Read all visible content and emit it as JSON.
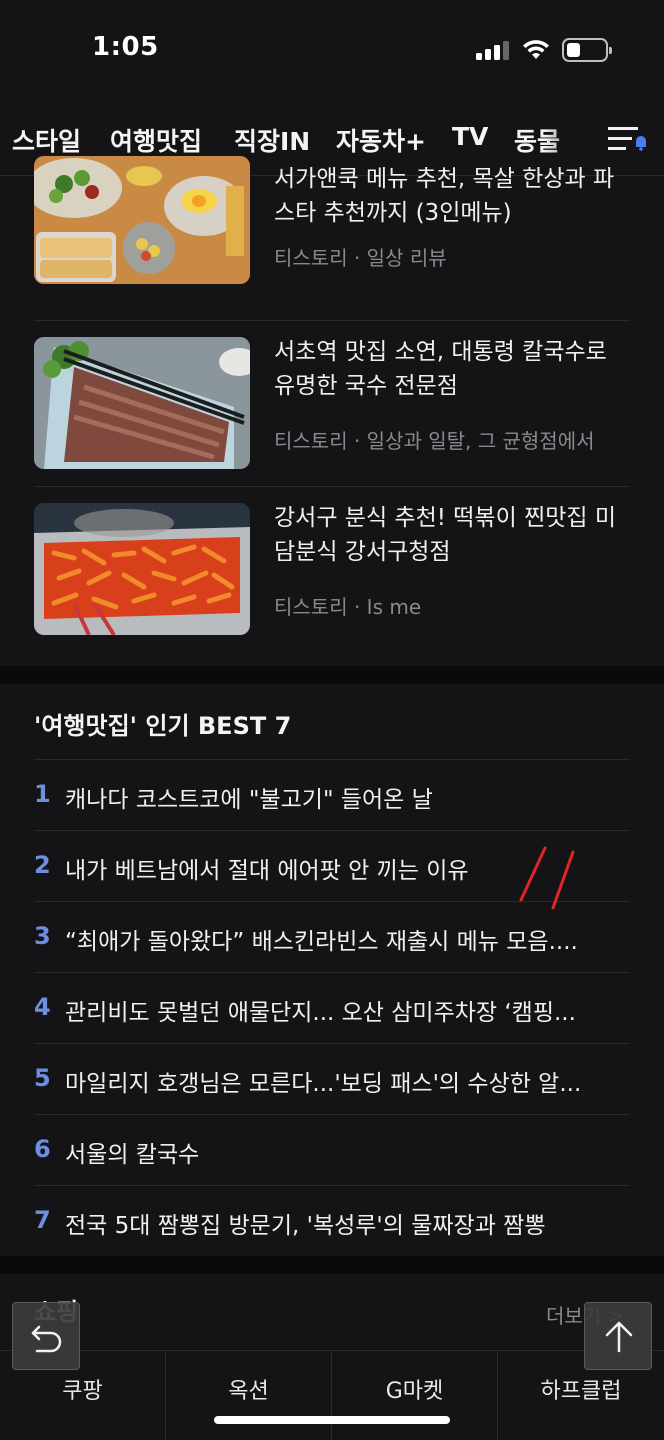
{
  "status_bar": {
    "time": "1:05"
  },
  "tabs": [
    {
      "label": "스타일",
      "active": false
    },
    {
      "label": "여행맛집",
      "active": true
    },
    {
      "label": "직장IN",
      "active": false
    },
    {
      "label": "자동차+",
      "active": false
    },
    {
      "label": "TV",
      "active": false
    },
    {
      "label": "동물",
      "active": false
    }
  ],
  "articles": [
    {
      "title": "서가앤쿡 메뉴 추천, 목살 한상과 파스타 추천까지 (3인메뉴)",
      "source": "티스토리 · 일상 리뷰"
    },
    {
      "title": "서초역 맛집 소연, 대통령 칼국수로 유명한 국수 전문점",
      "source": "티스토리 · 일상과 일탈, 그 균형점에서"
    },
    {
      "title": "강서구 분식 추천! 떡볶이 찐맛집 미담분식 강서구청점",
      "source": "티스토리 · Is me"
    }
  ],
  "popular": {
    "title": "'여행맛집' 인기 BEST 7",
    "items": [
      {
        "rank": "1",
        "text": "캐나다 코스트코에 \"불고기\" 들어온 날"
      },
      {
        "rank": "2",
        "text": "내가 베트남에서 절대 에어팟 안 끼는 이유"
      },
      {
        "rank": "3",
        "text": "“최애가 돌아왔다” 배스킨라빈스 재출시 메뉴 모음...."
      },
      {
        "rank": "4",
        "text": "관리비도 못벌던 애물단지... 오산 삼미주차장 ‘캠핑..."
      },
      {
        "rank": "5",
        "text": "마일리지 호갱님은 모른다...'보딩 패스'의 수상한 알..."
      },
      {
        "rank": "6",
        "text": "서울의 칼국수"
      },
      {
        "rank": "7",
        "text": "전국 5대 짬뽕집 방문기, '복성루'의 물짜장과 짬뽕"
      }
    ]
  },
  "shopping": {
    "title": "쇼핑",
    "more": "더보기 >",
    "items": [
      {
        "label": "쿠팡"
      },
      {
        "label": "옥션"
      },
      {
        "label": "G마켓"
      },
      {
        "label": "하프클럽"
      }
    ]
  },
  "colors": {
    "background": "#141416",
    "rank_accent": "#6d8fe0",
    "muted": "#8a8a8e",
    "annotation": "#e0252a"
  }
}
